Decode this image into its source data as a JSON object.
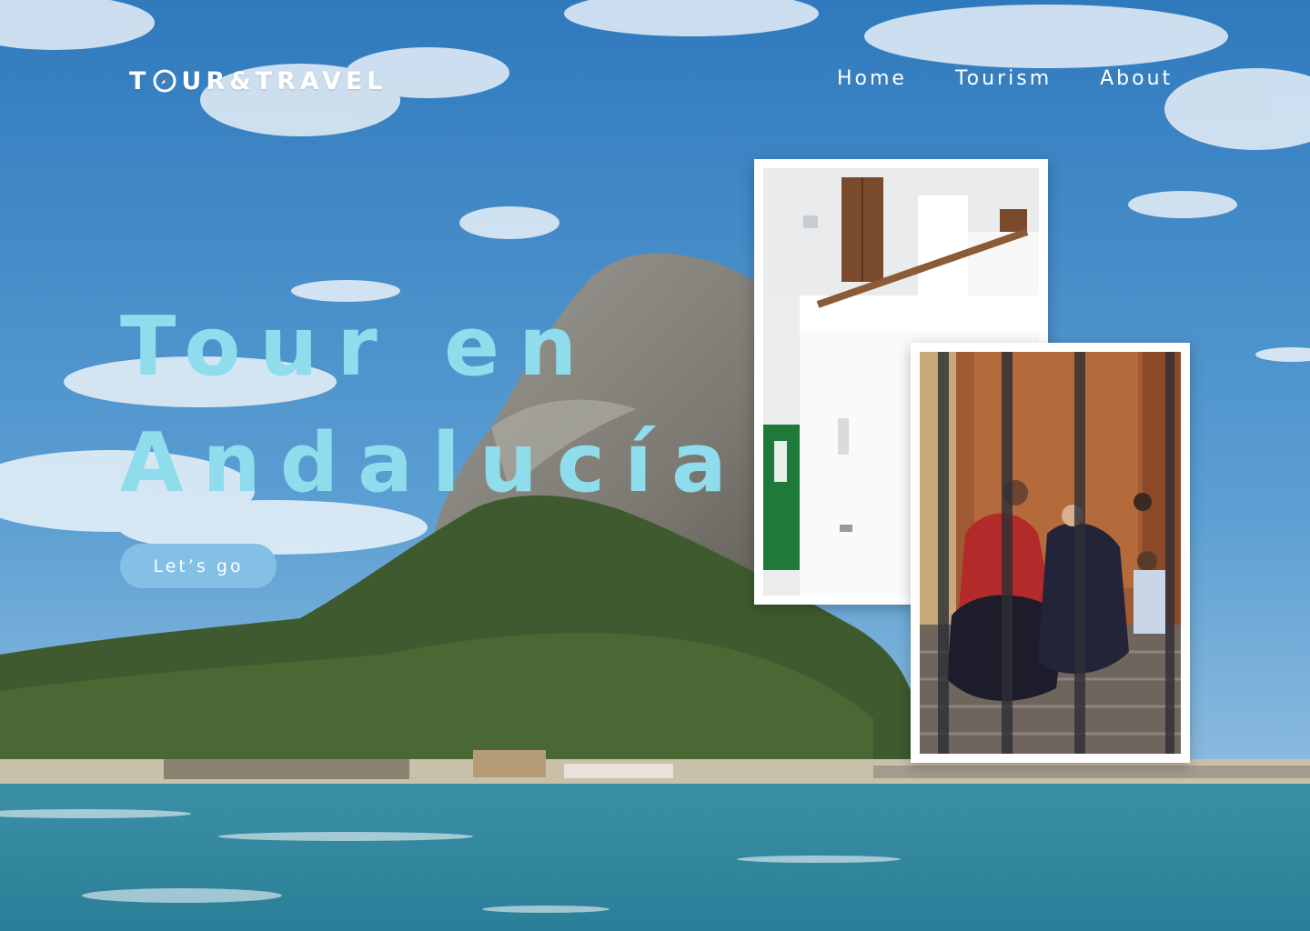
{
  "brand": {
    "logo_prefix": "T",
    "logo_suffix": "UR&TRAVEL",
    "logo_icon": "compass-icon"
  },
  "nav": {
    "items": [
      {
        "label": "Home"
      },
      {
        "label": "Tourism"
      },
      {
        "label": "About"
      }
    ]
  },
  "hero": {
    "headline_line1": "Tour en",
    "headline_line2": "Andalucía",
    "cta_label": "Let’s go",
    "headline_color": "#8fdcec",
    "cta_color": "#84bfe6"
  },
  "gallery": {
    "photos": [
      {
        "subject": "white-andalusian-house"
      },
      {
        "subject": "flamenco-dancers"
      }
    ]
  }
}
